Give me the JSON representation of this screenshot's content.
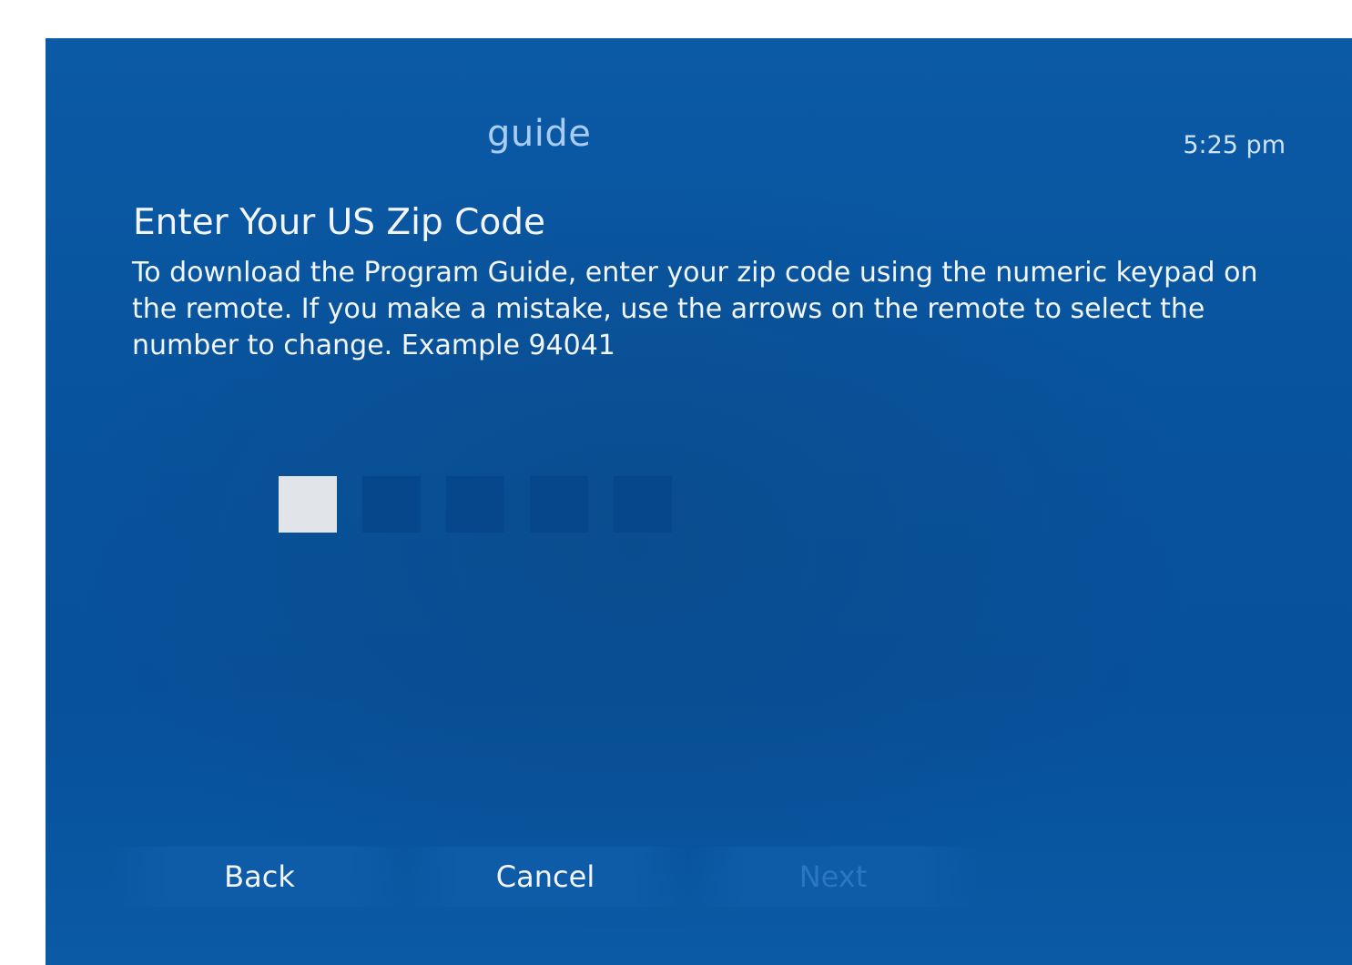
{
  "header": {
    "title": "guide",
    "clock": "5:25 pm"
  },
  "main": {
    "heading": "Enter Your US Zip Code",
    "instructions": "To download the Program Guide, enter your zip code using the numeric keypad on the remote. If you make a mistake, use the arrows on the remote to select the number to change. Example 94041"
  },
  "zip_entry": {
    "digits": [
      "",
      "",
      "",
      "",
      ""
    ],
    "active_index": 0
  },
  "buttons": {
    "back_label": "Back",
    "cancel_label": "Cancel",
    "next_label": "Next",
    "next_enabled": false
  },
  "colors": {
    "background": "#0b5aa6",
    "active_digit": "#e1e4e8",
    "inactive_digit": "#06468a",
    "title": "#a9cdf2"
  }
}
